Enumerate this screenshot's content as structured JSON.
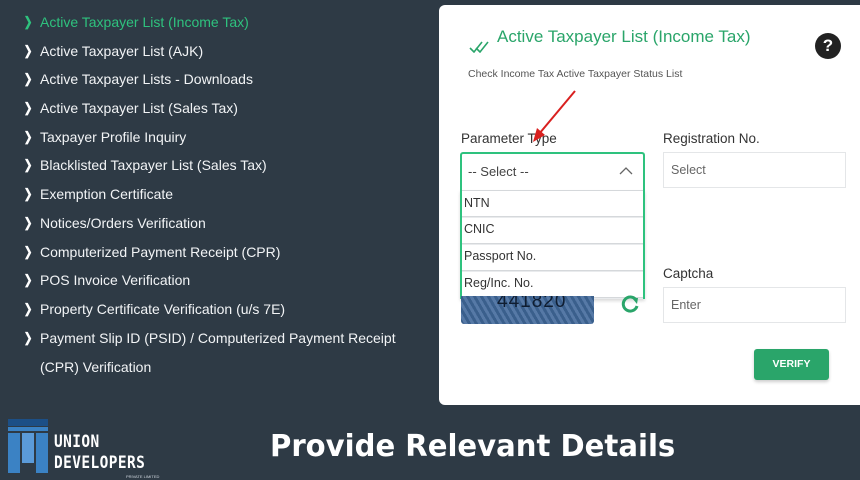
{
  "sidebar": {
    "items": [
      {
        "label": "Active Taxpayer List (Income Tax)",
        "active": true
      },
      {
        "label": "Active Taxpayer List (AJK)"
      },
      {
        "label": "Active Taxpayer Lists - Downloads"
      },
      {
        "label": "Active Taxpayer List (Sales Tax)"
      },
      {
        "label": "Taxpayer Profile Inquiry"
      },
      {
        "label": "Blacklisted Taxpayer List (Sales Tax)"
      },
      {
        "label": "Exemption Certificate"
      },
      {
        "label": "Notices/Orders Verification"
      },
      {
        "label": "Computerized Payment Receipt (CPR)"
      },
      {
        "label": "POS Invoice Verification"
      },
      {
        "label": "Property Certificate Verification (u/s 7E)"
      },
      {
        "label": "Payment Slip ID (PSID) / Computerized Payment Receipt (CPR) Verification"
      }
    ]
  },
  "card": {
    "title": "Active Taxpayer List (Income Tax)",
    "subtitle": "Check Income Tax Active Taxpayer Status List",
    "help": "?",
    "parameter_label": "Parameter Type",
    "parameter_value": "-- Select --",
    "options": [
      "NTN",
      "CNIC",
      "Passport No.",
      "Reg/Inc. No."
    ],
    "registration_label": "Registration No.",
    "registration_placeholder": "Select",
    "captcha_label": "Captcha",
    "captcha_value": "441820",
    "captcha_placeholder": "Enter",
    "verify_label": "VERIFY"
  },
  "logo": {
    "line1": "UNION",
    "line2": "DEVELOPERS",
    "small": "PRIVATE LIMITED"
  },
  "caption": "Provide Relevant Details",
  "colors": {
    "background": "#2e3a45",
    "accent": "#2aa56a",
    "active_nav": "#2ec27e",
    "arrow": "#d9201f",
    "logo_blue": "#3b82c4"
  }
}
